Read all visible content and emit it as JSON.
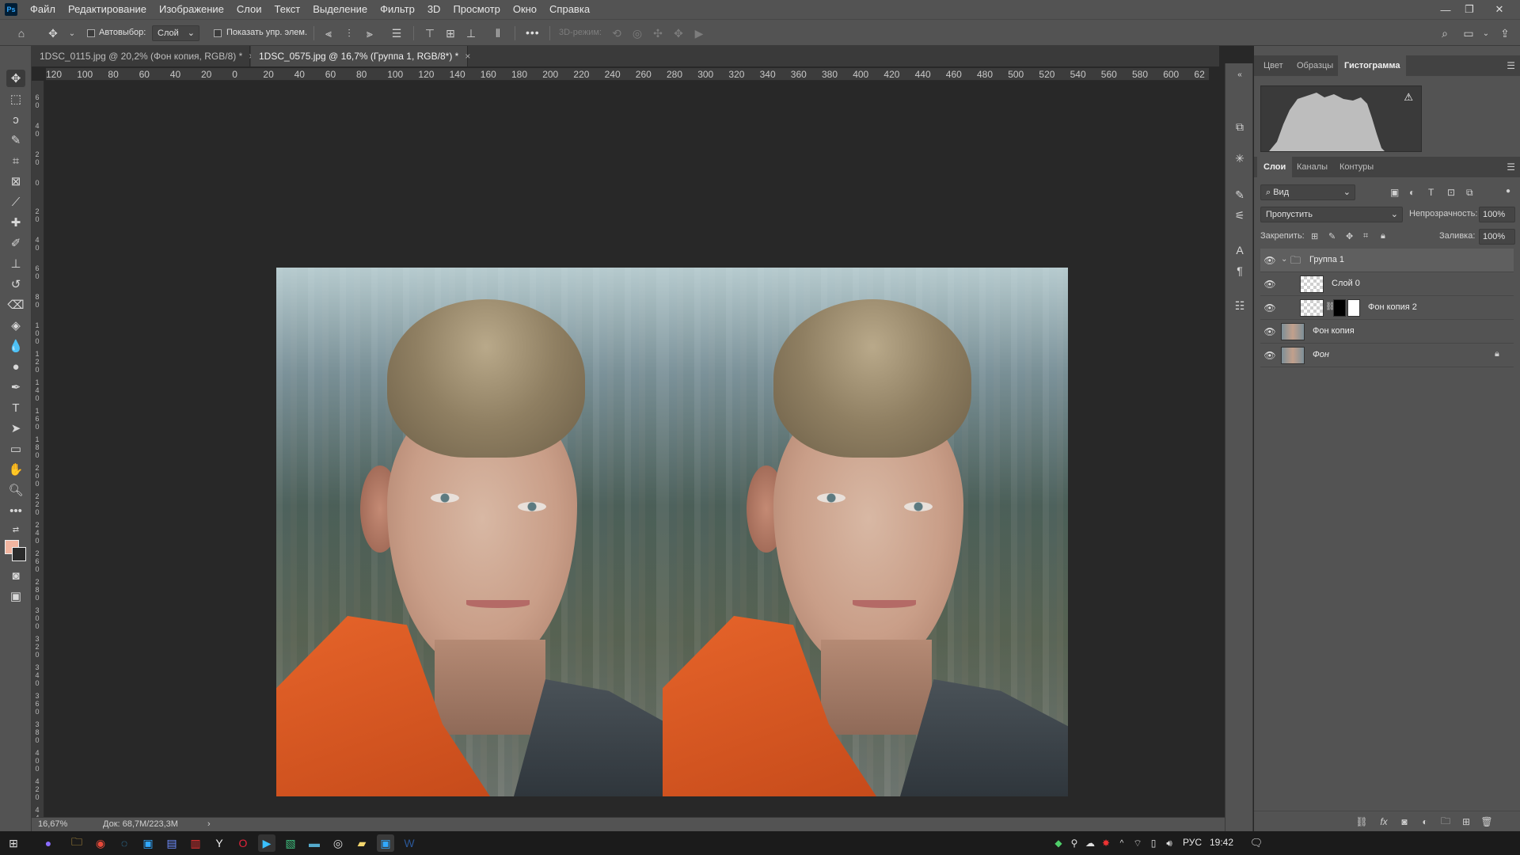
{
  "app": {
    "logo": "Ps",
    "menu": [
      "Файл",
      "Редактирование",
      "Изображение",
      "Слои",
      "Текст",
      "Выделение",
      "Фильтр",
      "3D",
      "Просмотр",
      "Окно",
      "Справка"
    ]
  },
  "options_bar": {
    "autoselect_label": "Автовыбор:",
    "autoselect_value": "Слой",
    "show_transform_label": "Показать упр. элем.",
    "mode_3d_label": "3D-режим:",
    "more": "•••"
  },
  "tabs": [
    {
      "label": "1DSC_0115.jpg @ 20,2% (Фон копия, RGB/8) *",
      "close": "×"
    },
    {
      "label": "1DSC_0575.jpg @ 16,7% (Группа 1, RGB/8*) *",
      "close": "×"
    }
  ],
  "ruler_h": [
    "120",
    "100",
    "80",
    "60",
    "40",
    "20",
    "0",
    "20",
    "40",
    "60",
    "80",
    "100",
    "120",
    "140",
    "160",
    "180",
    "200",
    "220",
    "240",
    "260",
    "280",
    "300",
    "320",
    "340",
    "360",
    "380",
    "400",
    "420",
    "440",
    "460",
    "480",
    "500",
    "520",
    "540",
    "560",
    "580",
    "600",
    "62"
  ],
  "ruler_v": [
    "60",
    "40",
    "20",
    "0",
    "20",
    "40",
    "60",
    "80",
    "100",
    "120",
    "140",
    "160",
    "180",
    "200",
    "220",
    "240",
    "260",
    "280",
    "300",
    "320",
    "340",
    "360",
    "380",
    "400",
    "420",
    "440",
    "460"
  ],
  "panels": {
    "top_tabs": [
      "Цвет",
      "Образцы",
      "Гистограмма"
    ],
    "top_active": 2,
    "histogram_warning": "⚠",
    "layer_tabs": [
      "Слои",
      "Каналы",
      "Контуры"
    ],
    "layer_active": 0,
    "filter_label": "Вид",
    "blend_mode": "Пропустить",
    "opacity_label": "Непрозрачность:",
    "opacity_value": "100%",
    "lock_label": "Закрепить:",
    "fill_label": "Заливка:",
    "fill_value": "100%",
    "layers": [
      {
        "name": "Группа 1",
        "type": "group",
        "selected": true
      },
      {
        "name": "Слой 0",
        "type": "layer",
        "indent": true,
        "thumb": "checker"
      },
      {
        "name": "Фон копия 2",
        "type": "layer-mask",
        "indent": true,
        "thumb": "checker"
      },
      {
        "name": "Фон копия",
        "type": "layer",
        "thumb": "photo"
      },
      {
        "name": "Фон",
        "type": "background",
        "thumb": "photo",
        "locked": true
      }
    ]
  },
  "status": {
    "zoom": "16,67%",
    "doc": "Док: 68,7M/223,3M",
    "arrow": "›"
  },
  "taskbar": {
    "lang": "РУС",
    "time": "19:42"
  },
  "colors": {
    "foreground": "#f2b5a0",
    "background": "#2a2a2a",
    "accent": "#31a8ff"
  }
}
